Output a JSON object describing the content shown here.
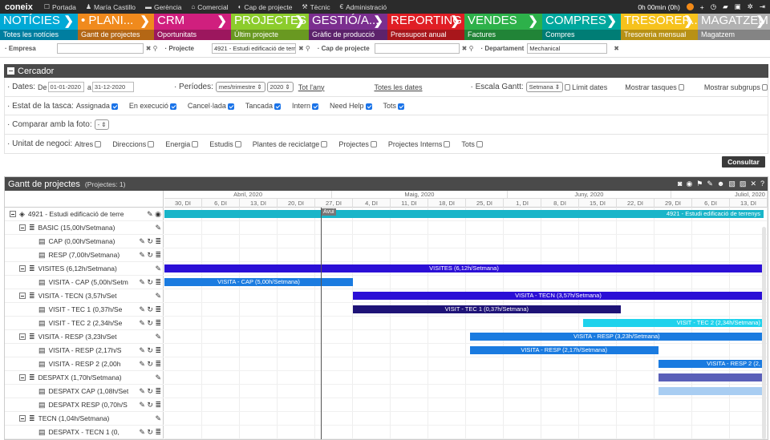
{
  "topbar": {
    "logo": "coneix",
    "links": [
      {
        "icon": "monitor-icon",
        "glyph": "☐",
        "label": "Portada"
      },
      {
        "icon": "user-icon",
        "glyph": "♟",
        "label": "María Castillo"
      },
      {
        "icon": "briefcase-icon",
        "glyph": "▬",
        "label": "Gerència"
      },
      {
        "icon": "building-icon",
        "glyph": "⌂",
        "label": "Comercial"
      },
      {
        "icon": "helmet-icon",
        "glyph": "◐",
        "label": "Cap de projecte"
      },
      {
        "icon": "wrench-icon",
        "glyph": "⚒",
        "label": "Tècnic"
      },
      {
        "icon": "euro-icon",
        "glyph": "€",
        "label": "Administració"
      }
    ],
    "timer": "0h 00min (0h)"
  },
  "modules": [
    {
      "title": "NOTÍCIES",
      "sub": "Totes les notícies",
      "color": "#00a9d6"
    },
    {
      "title": "• PLANI...",
      "sub": "Gantt de projectes",
      "color": "#f08a1d"
    },
    {
      "title": "CRM",
      "sub": "Oportunitats",
      "color": "#d01f7e"
    },
    {
      "title": "PROJECTES",
      "sub": "Últim projecte",
      "color": "#8ccc2c"
    },
    {
      "title": "GESTIÓ/A...",
      "sub": "Gràfic de producció",
      "color": "#7b2e8f"
    },
    {
      "title": "REPORTING",
      "sub": "Pressupost anual",
      "color": "#e01e25"
    },
    {
      "title": "VENDES",
      "sub": "Factures",
      "color": "#2db14a"
    },
    {
      "title": "COMPRES",
      "sub": "Compres",
      "color": "#00a79d"
    },
    {
      "title": "TRESORER...",
      "sub": "Tresoreria mensual",
      "color": "#f6c21c"
    },
    {
      "title": "MAGATZEM",
      "sub": "Magatzem",
      "color": "#b1b1b1"
    }
  ],
  "filters": {
    "empresa_label": "· Empresa",
    "empresa_value": "",
    "projecte_label": "· Projecte",
    "projecte_value": "4921 - Estudi edificació de terre",
    "cap_label": "· Cap de projecte",
    "cap_value": "",
    "dept_label": "· Departament",
    "dept_value": "Mechanical"
  },
  "cercador": {
    "title": "Cercador",
    "dates_label": "· Dates:",
    "de": "De",
    "date_from": "01-01-2020",
    "a": "a",
    "date_to": "31-12-2020",
    "periodes_label": "· Períodes:",
    "periode_sel": "mes/trimestre ⇕",
    "year_sel": "2020 ⇕",
    "tot_any": "Tot l'any",
    "totes_dates": "Totes les dates",
    "escala_label": "· Escala Gantt:",
    "escala_sel": "Setmana ⇕",
    "limit_dates": "Límit dates",
    "mostrar_tasques": "Mostrar tasques",
    "mostrar_subgrups": "Mostrar subgrups",
    "estat_label": "· Estat de la tasca:",
    "estats": [
      {
        "label": "Assignada",
        "on": true
      },
      {
        "label": "En execució",
        "on": true
      },
      {
        "label": "Cancel·lada",
        "on": true
      },
      {
        "label": "Tancada",
        "on": true
      },
      {
        "label": "Intern",
        "on": true
      },
      {
        "label": "Need Help",
        "on": true
      },
      {
        "label": "Tots",
        "on": true
      }
    ],
    "foto_label": "· Comparar amb la foto:",
    "foto_sel": "- ⇕",
    "unitat_label": "· Unitat de negoci:",
    "unitats": [
      "Altres",
      "Direccions",
      "Energia",
      "Estudis",
      "Plantes de reciclatge",
      "Projectes",
      "Projectes Interns",
      "Tots"
    ],
    "consultar": "Consultar"
  },
  "gantt": {
    "title": "Gantt de projectes",
    "count": "(Projectes: 1)",
    "today_label": "Avui",
    "months": [
      {
        "label": "Abril, 2020"
      },
      {
        "label": "Maig, 2020"
      },
      {
        "label": "Juny, 2020"
      },
      {
        "label": "Juliol, 2020"
      }
    ],
    "weeks": [
      "30, DI",
      "6, DI",
      "13, DI",
      "20, DI",
      "27, DI",
      "4, DI",
      "11, DI",
      "18, DI",
      "25, DI",
      "1, DI",
      "8, DI",
      "15, DI",
      "22, DI",
      "29, DI",
      "6, DI",
      "13, DI"
    ],
    "rows": [
      {
        "label": "4921 - Estudi edificació de terre",
        "icon": "cube-icon",
        "glyph": "◈",
        "toggle": true,
        "indent": 0,
        "acts": "✎ ◉",
        "bar": {
          "label": "4921 - Estudi edificació de terrenys",
          "color": "#19b5c9",
          "from": 0,
          "to": 16,
          "align": "right"
        }
      },
      {
        "label": "BASIC (15,00h/Setmana)",
        "icon": "list-icon",
        "glyph": "≣",
        "toggle": true,
        "indent": 1,
        "acts": "✎"
      },
      {
        "label": "CAP (0,00h/Setmana)",
        "icon": "task-icon",
        "glyph": "▤",
        "toggle": false,
        "indent": 2,
        "acts": "✎ ↻ ≣"
      },
      {
        "label": "RESP (7,00h/Setmana)",
        "icon": "task-icon",
        "glyph": "▤",
        "toggle": false,
        "indent": 2,
        "acts": "✎ ↻ ≣"
      },
      {
        "label": "VISITES (6,12h/Setmana)",
        "icon": "list-icon",
        "glyph": "≣",
        "toggle": true,
        "indent": 1,
        "acts": "✎",
        "bar": {
          "label": "VISITES (6,12h/Setmana)",
          "color": "#2b0fd6",
          "from": 0,
          "to": 16,
          "align": "center"
        }
      },
      {
        "label": "VISITA - CAP (5,00h/Setm",
        "icon": "task-icon",
        "glyph": "▤",
        "toggle": false,
        "indent": 2,
        "acts": "✎ ↻ ≣",
        "bar": {
          "label": "VISITA - CAP (5,00h/Setmana)",
          "color": "#1a7be0",
          "from": 0,
          "to": 5,
          "align": "center"
        }
      },
      {
        "label": "VISITA - TECN (3,57h/Set",
        "icon": "list-icon",
        "glyph": "≣",
        "toggle": true,
        "indent": 1,
        "acts": "✎",
        "bar": {
          "label": "VISITA - TECN (3,57h/Setmana)",
          "color": "#2b0fd6",
          "from": 5,
          "to": 16,
          "align": "center"
        }
      },
      {
        "label": "VISIT - TEC 1 (0,37h/Se",
        "icon": "task-icon",
        "glyph": "▤",
        "toggle": false,
        "indent": 2,
        "acts": "✎ ↻ ≣",
        "bar": {
          "label": "VISIT - TEC 1 (0,37h/Setmana)",
          "color": "#1e1377",
          "from": 5,
          "to": 12.1,
          "align": "center"
        }
      },
      {
        "label": "VISIT - TEC 2 (2,34h/Se",
        "icon": "task-icon",
        "glyph": "▤",
        "toggle": false,
        "indent": 2,
        "acts": "✎ ↻ ≣",
        "bar": {
          "label": "VISIT - TEC 2 (2,34h/Setmana)",
          "color": "#1fd2ec",
          "from": 11.1,
          "to": 16,
          "align": "right"
        }
      },
      {
        "label": "VISITA - RESP (3,23h/Set",
        "icon": "list-icon",
        "glyph": "≣",
        "toggle": true,
        "indent": 1,
        "acts": "✎",
        "bar": {
          "label": "VISITA - RESP (3,23h/Setmana)",
          "color": "#1a7be0",
          "from": 8.1,
          "to": 16,
          "align": "center"
        }
      },
      {
        "label": "VISITA - RESP (2,17h/S",
        "icon": "task-icon",
        "glyph": "▤",
        "toggle": false,
        "indent": 2,
        "acts": "✎ ↻ ≣",
        "bar": {
          "label": "VISITA - RESP (2,17h/Setmana)",
          "color": "#1a7be0",
          "from": 8.1,
          "to": 13.1,
          "align": "center"
        }
      },
      {
        "label": "VISITA - RESP 2 (2,00h",
        "icon": "task-icon",
        "glyph": "▤",
        "toggle": false,
        "indent": 2,
        "acts": "✎ ↻ ≣",
        "bar": {
          "label": "VISITA - RESP 2 (2,",
          "color": "#1a7be0",
          "from": 13.1,
          "to": 16,
          "align": "right"
        }
      },
      {
        "label": "DESPATX (1,70h/Setmana)",
        "icon": "list-icon",
        "glyph": "≣",
        "toggle": true,
        "indent": 1,
        "acts": "✎",
        "bar": {
          "label": "",
          "color": "#5a5fb8",
          "from": 13.1,
          "to": 16,
          "align": "center"
        }
      },
      {
        "label": "DESPATX CAP (1,08h/Set",
        "icon": "task-icon",
        "glyph": "▤",
        "toggle": false,
        "indent": 2,
        "acts": "✎ ↻ ≣",
        "bar": {
          "label": "",
          "color": "#a8cdf2",
          "from": 13.1,
          "to": 16,
          "align": "center"
        }
      },
      {
        "label": "DESPATX RESP (0,70h/S",
        "icon": "task-icon",
        "glyph": "▤",
        "toggle": false,
        "indent": 2,
        "acts": "✎ ↻ ≣"
      },
      {
        "label": "TECN (1,04h/Setmana)",
        "icon": "list-icon",
        "glyph": "≣",
        "toggle": true,
        "indent": 1,
        "acts": "✎"
      },
      {
        "label": "DESPATX - TECN 1 (0,",
        "icon": "task-icon",
        "glyph": "▤",
        "toggle": false,
        "indent": 2,
        "acts": "✎ ↻ ≣"
      }
    ],
    "today_week": 4.15
  }
}
